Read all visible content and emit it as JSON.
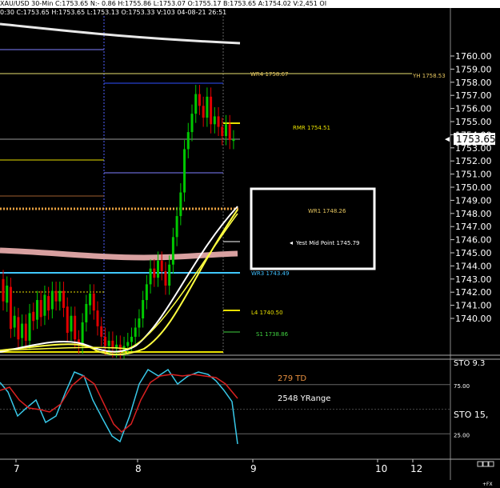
{
  "header": {
    "symbol": "XAU/USD 30-Min",
    "close": "C:1753.65",
    "change": "N:- 0.86",
    "high": "H:1755.86",
    "low": "L:1753.07",
    "open": "O:1755.17",
    "bid": "B:1753.65",
    "ask": "A:1754.02",
    "volume": "V:2,451",
    "oi": "OI"
  },
  "timebar": "0:30 C:1753.65 H:1753.65 L:1753.13 O:1753.33 V:103 04-08-21 26:51",
  "colors": {
    "background": "#000000",
    "up_candle": "#00c800",
    "down_candle": "#e00000",
    "stoch_k": "#38c8e8",
    "stoch_d": "#d82020",
    "ma_yellow": "#ffff40",
    "ma_white": "#ffffff"
  },
  "chart_data": [
    {
      "type": "candlestick",
      "title": "",
      "price_axis": {
        "ticks": [
          1760.0,
          1759.0,
          1758.0,
          1757.0,
          1756.0,
          1755.0,
          1754.0,
          1753.0,
          1752.0,
          1751.0,
          1750.0,
          1749.0,
          1748.0,
          1747.0,
          1746.0,
          1745.0,
          1744.0,
          1743.0,
          1742.0,
          1741.0,
          1740.0
        ],
        "tick_labels": [
          "1760.00",
          "1759.00",
          "1758.00",
          "1757.00",
          "1756.00",
          "1755.00",
          "1754.00",
          "1753.00",
          "1752.00",
          "1751.00",
          "1750.00",
          "1749.00",
          "1748.00",
          "1747.00",
          "1746.00",
          "1745.00",
          "1744.00",
          "1743.00",
          "1742.00",
          "1741.00",
          "1740.00"
        ],
        "current_price_label": "1753.65",
        "range": [
          1737.4,
          1763.0
        ]
      },
      "time_axis": {
        "labels": [
          "7",
          "8",
          "9",
          "10",
          "12"
        ]
      },
      "levels": [
        {
          "label": "WR4 1758.67",
          "price": 1758.67,
          "color": "#e8c860"
        },
        {
          "label": "YH 1758.53",
          "price": 1758.53,
          "color": "#e8c860"
        },
        {
          "label": "RMR 1754.51",
          "price": 1754.51,
          "color": "#e8e000"
        },
        {
          "label": "WR1 1748.26",
          "price": 1748.26,
          "color": "#e8c860"
        },
        {
          "label": "Yest Mid Point 1745.79",
          "price": 1745.79,
          "color": "#ffffff"
        },
        {
          "label": "WR3 1743.49",
          "price": 1743.49,
          "color": "#40c0ff"
        },
        {
          "label": "L4 1740.50",
          "price": 1740.5,
          "color": "#e8e000"
        },
        {
          "label": "S1 1738.86",
          "price": 1738.86,
          "color": "#40d040"
        }
      ]
    },
    {
      "type": "line",
      "title": "",
      "labels": [
        "279 TD",
        "2548 YRange",
        "STO 9.3",
        "STO 15,"
      ],
      "y_ticks": [
        25.0,
        75.0
      ],
      "y_tick_labels": [
        "25.00",
        "75.00"
      ],
      "range": [
        0,
        100
      ]
    }
  ],
  "footer": {
    "fx_label": "+FX"
  }
}
